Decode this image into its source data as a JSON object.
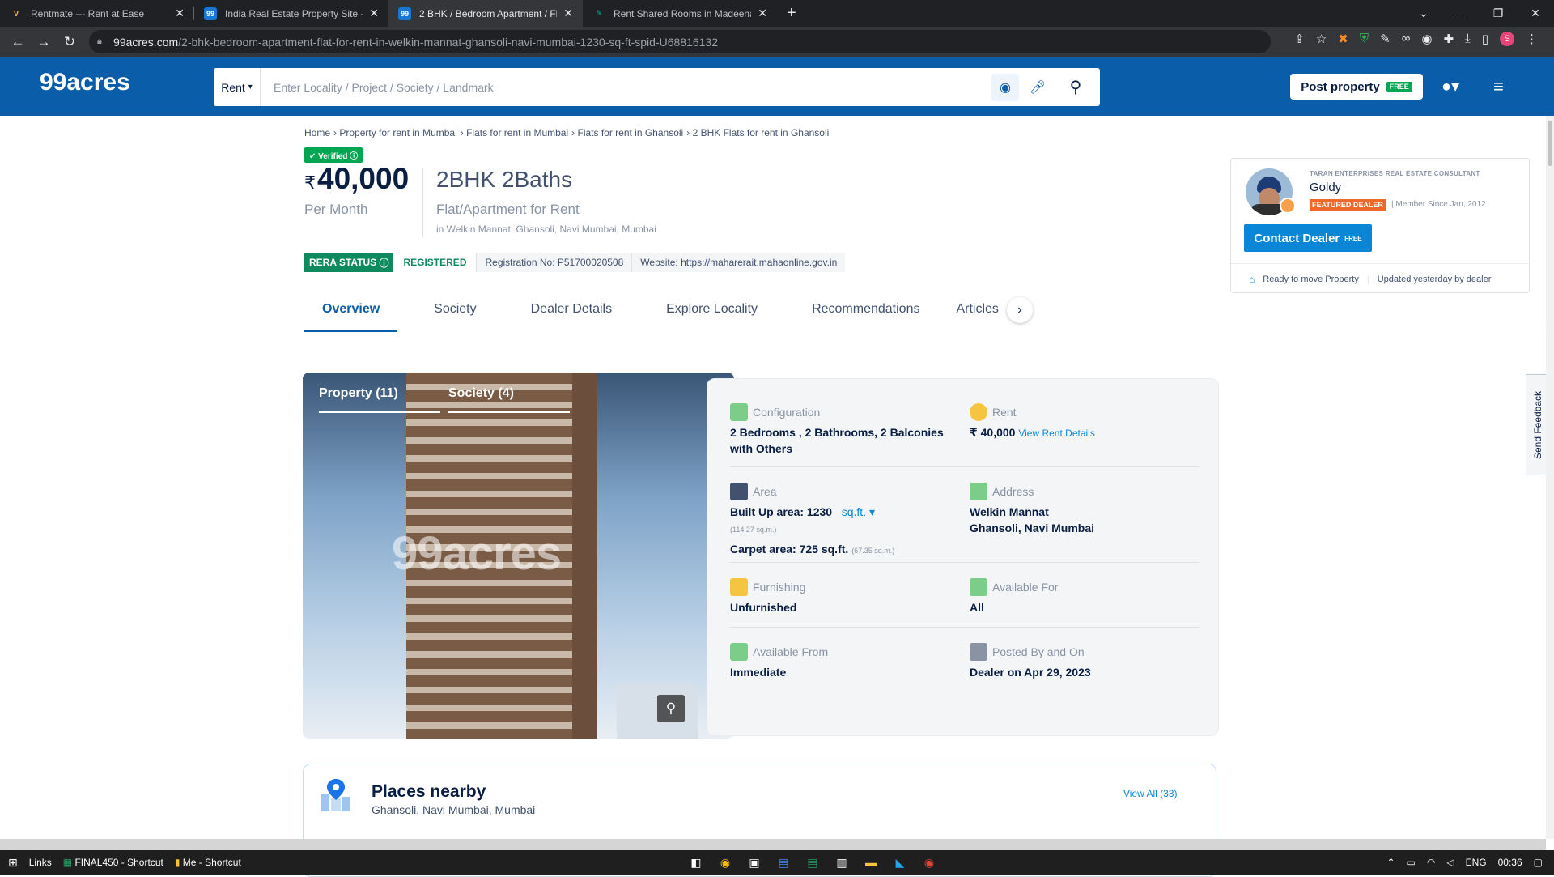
{
  "browser": {
    "tabs": [
      {
        "title": "Rentmate --- Rent at Ease",
        "favicon": "v-logo-icon",
        "active": false
      },
      {
        "title": "India Real Estate Property Site - B",
        "favicon": "99acres-icon",
        "active": false
      },
      {
        "title": "2 BHK / Bedroom Apartment / Fl",
        "favicon": "99acres-icon",
        "active": true
      },
      {
        "title": "Rent Shared Rooms in Madeena",
        "favicon": "green-logo-icon",
        "active": false
      }
    ],
    "url_domain": "99acres.com",
    "url_path": "/2-bhk-bedroom-apartment-flat-for-rent-in-welkin-mannat-ghansoli-navi-mumbai-1230-sq-ft-spid-U68816132",
    "profile_initial": "S"
  },
  "header": {
    "logo": "99acres",
    "search_mode": "Rent",
    "search_placeholder": "Enter Locality / Project / Society / Landmark",
    "post_property": "Post property",
    "free_badge": "FREE",
    "brand_color": "#0a5da8"
  },
  "breadcrumb": [
    "Home",
    "Property for rent in Mumbai",
    "Flats for rent in Mumbai",
    "Flats for rent in Ghansoli",
    "2 BHK Flats for rent in Ghansoli"
  ],
  "listing": {
    "verified": "Verified",
    "currency": "₹",
    "price": "40,000",
    "price_period": "Per Month",
    "title": "2BHK 2Baths",
    "type": "Flat/Apartment for Rent",
    "location": "in Welkin Mannat, Ghansoli, Navi Mumbai, Mumbai",
    "rera_label": "RERA STATUS",
    "rera_status": "REGISTERED",
    "registration": "Registration No: P51700020508",
    "website": "Website: https://maharerait.mahaonline.gov.in"
  },
  "page_tabs": [
    "Overview",
    "Society",
    "Dealer Details",
    "Explore Locality",
    "Recommendations",
    "Articles"
  ],
  "dealer": {
    "company": "TARAN ENTERPRISES REAL ESTATE CONSULTANT",
    "name": "Goldy",
    "badge": "FEATURED DEALER",
    "since": "Member Since Jan, 2012",
    "contact": "Contact Dealer",
    "contact_free": "FREE",
    "ready": "Ready to move Property",
    "updated": "Updated yesterday by dealer"
  },
  "gallery": {
    "tab_property": "Property (11)",
    "tab_society": "Society (4)",
    "watermark": "99acres"
  },
  "details": {
    "configuration_label": "Configuration",
    "configuration": "2 Bedrooms , 2 Bathrooms, 2 Balconies with Others",
    "rent_label": "Rent",
    "rent": "₹ 40,000",
    "rent_link": "View Rent Details",
    "area_label": "Area",
    "built_up": "Built Up area: 1230",
    "area_unit": "sq.ft.",
    "built_up_sqm": "(114.27 sq.m.)",
    "carpet": "Carpet area: 725 sq.ft.",
    "carpet_sqm": "(67.35 sq.m.)",
    "address_label": "Address",
    "address_line1": "Welkin Mannat",
    "address_line2": "Ghansoli, Navi Mumbai",
    "furnishing_label": "Furnishing",
    "furnishing": "Unfurnished",
    "available_for_label": "Available For",
    "available_for": "All",
    "available_from_label": "Available From",
    "available_from": "Immediate",
    "posted_label": "Posted By and On",
    "posted": "Dealer on Apr 29, 2023"
  },
  "places": {
    "title": "Places nearby",
    "subtitle": "Ghansoli, Navi Mumbai, Mumbai",
    "view_all": "View All (33)"
  },
  "feedback": "Send Feedback",
  "taskbar": {
    "links": "Links",
    "shortcut1": "FINAL450 - Shortcut",
    "shortcut2": "Me - Shortcut",
    "lang": "ENG",
    "time": "00:36"
  }
}
